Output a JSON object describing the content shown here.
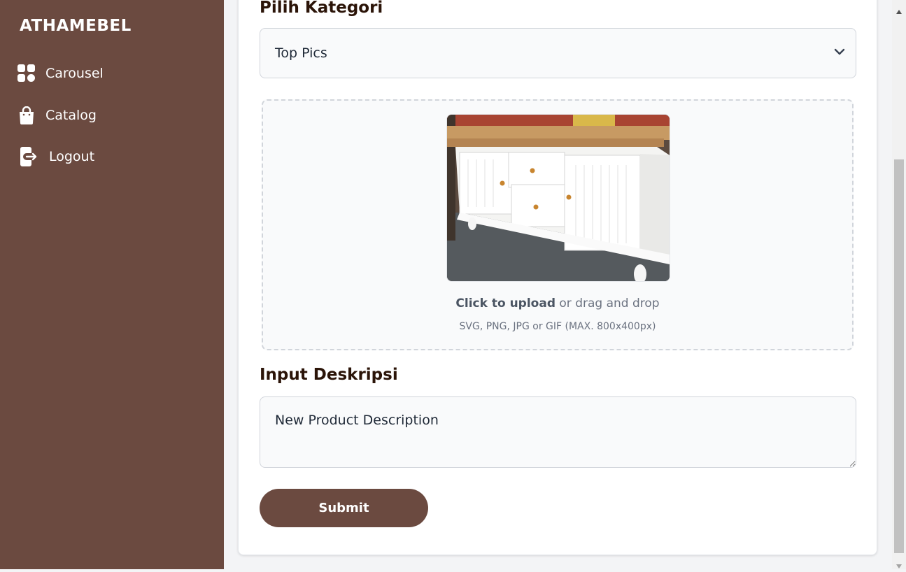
{
  "sidebar": {
    "brand": "ATHAMEBEL",
    "items": [
      {
        "label": "Carousel",
        "icon": "grid-icon"
      },
      {
        "label": "Catalog",
        "icon": "shopping-bag-icon"
      },
      {
        "label": "Logout",
        "icon": "logout-icon"
      }
    ]
  },
  "form": {
    "category_label": "Pilih Kategori",
    "category_value": "Top Pics",
    "upload": {
      "cta_bold": "Click to upload",
      "cta_rest": " or drag and drop",
      "hint": "SVG, PNG, JPG or GIF (MAX. 800x400px)"
    },
    "description_label": "Input Deskripsi",
    "description_value": "New Product Description",
    "submit_label": "Submit"
  },
  "colors": {
    "sidebar": "#6b4a40",
    "accent": "#6b4a40",
    "heading": "#2b1408"
  }
}
